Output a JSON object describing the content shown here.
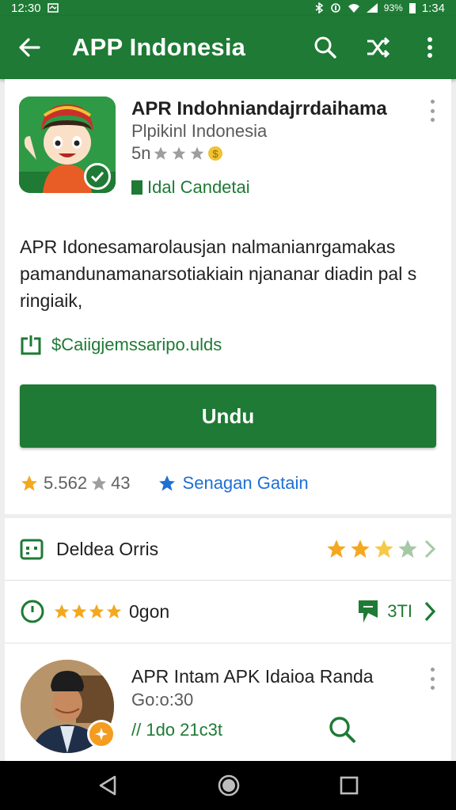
{
  "status_bar": {
    "time_left": "12:30",
    "battery": "93%",
    "time_right": "1:34"
  },
  "app_bar": {
    "title": "APP Indonesia"
  },
  "app": {
    "name": "APR Indohniandajrrdaihama",
    "developer": "Plpikinl Indonesia",
    "rating_text": "5n",
    "tag": "Idal Candetai"
  },
  "description": "APR Idonesamarolausjan nalmanianrgamakas pamandunamanarsotiakiain njananar diadin pal s ringiaik,",
  "link": {
    "label": "$Caiigjemssaripo.ulds"
  },
  "install_button": {
    "label": "Undu"
  },
  "stats": {
    "rating": "5.562",
    "reviews": "43",
    "link_label": "Senagan Gatain"
  },
  "rows": [
    {
      "label": "Deldea Orris",
      "stars": 4
    },
    {
      "label": "0gon",
      "value": "3TI"
    }
  ],
  "review": {
    "title": "APR Intam APK Idaioa Randa",
    "subtitle": "Go:o:30",
    "meta": "// 1do 21c3t"
  },
  "colors": {
    "brand": "#1e7a34",
    "star": "#f4a81d",
    "link": "#1e6fd6"
  },
  "icons": [
    "back-icon",
    "search-icon",
    "shuffle-icon",
    "more-icon",
    "open-external-icon",
    "star-icon",
    "calendar-icon",
    "clock-icon",
    "bookmark-icon",
    "chevron-right-icon",
    "nav-back-icon",
    "nav-home-icon",
    "nav-recents-icon"
  ]
}
